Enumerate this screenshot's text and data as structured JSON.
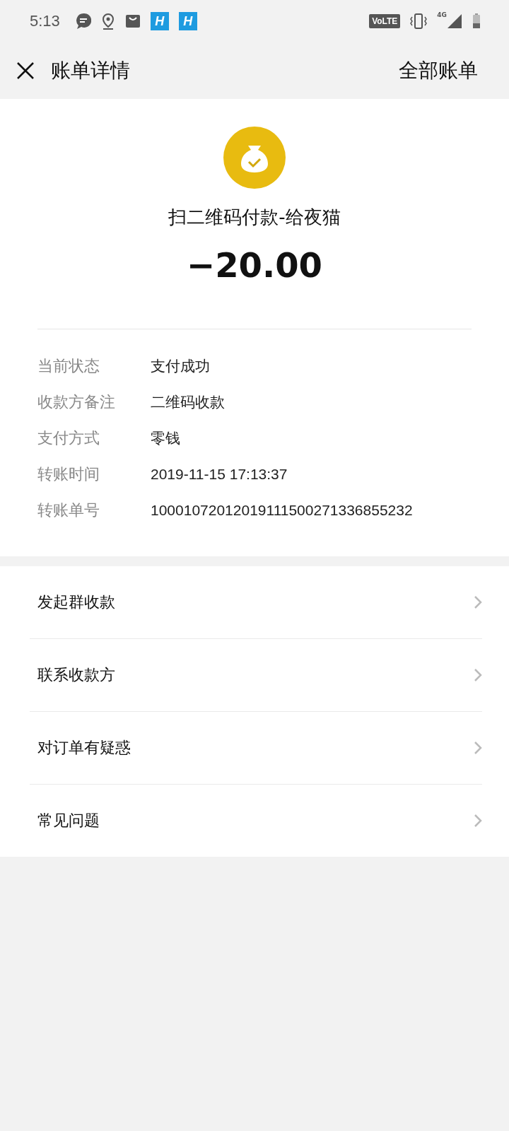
{
  "status_bar": {
    "time": "5:13",
    "app_badges": [
      "H",
      "H"
    ],
    "volte": "VoLTE",
    "network": "4G"
  },
  "header": {
    "title": "账单详情",
    "action": "全部账单"
  },
  "payment": {
    "title": "扫二维码付款-给夜猫",
    "amount": "−20.00"
  },
  "details": [
    {
      "label": "当前状态",
      "value": "支付成功"
    },
    {
      "label": "收款方备注",
      "value": "二维码收款"
    },
    {
      "label": "支付方式",
      "value": "零钱"
    },
    {
      "label": "转账时间",
      "value": "2019-11-15 17:13:37"
    },
    {
      "label": "转账单号",
      "value": "10001072012019111500271336855232"
    }
  ],
  "menu": [
    {
      "label": "发起群收款"
    },
    {
      "label": "联系收款方"
    },
    {
      "label": "对订单有疑惑"
    },
    {
      "label": "常见问题"
    }
  ]
}
